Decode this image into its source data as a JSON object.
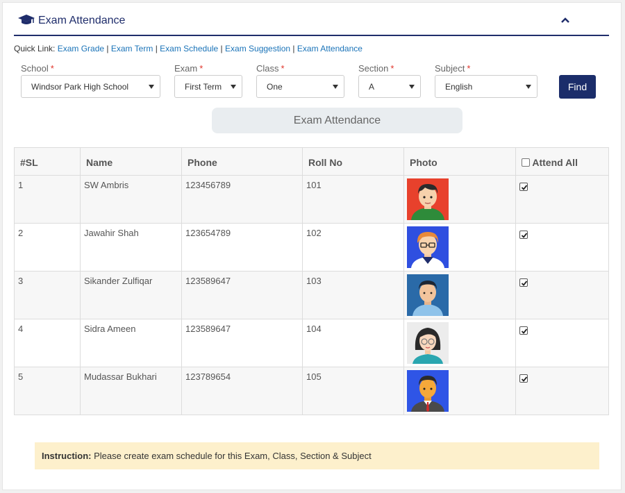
{
  "header": {
    "title": "Exam Attendance",
    "icon": "graduation-cap-icon",
    "collapse_icon": "chevron-up-icon",
    "accent": "#1f2d6b"
  },
  "quick_links": {
    "label": "Quick Link:",
    "links": [
      "Exam Grade",
      "Exam Term",
      "Exam Schedule",
      "Exam Suggestion",
      "Exam Attendance"
    ]
  },
  "filters": {
    "school": {
      "label": "School",
      "value": "Windsor Park High School"
    },
    "exam": {
      "label": "Exam",
      "value": "First Term"
    },
    "class": {
      "label": "Class",
      "value": "One"
    },
    "section": {
      "label": "Section",
      "value": "A"
    },
    "subject": {
      "label": "Subject",
      "value": "English"
    },
    "required_mark": "*",
    "find_label": "Find"
  },
  "banner": {
    "text": "Exam Attendance"
  },
  "table": {
    "headers": [
      "#SL",
      "Name",
      "Phone",
      "Roll No",
      "Photo",
      "Attend All"
    ],
    "rows": [
      {
        "sl": "1",
        "name": "SW Ambris",
        "phone": "123456789",
        "roll": "101",
        "photo": "avatar-boy-green-icon",
        "attend": true
      },
      {
        "sl": "2",
        "name": "Jawahir Shah",
        "phone": "123654789",
        "roll": "102",
        "photo": "avatar-man-glasses-icon",
        "attend": true
      },
      {
        "sl": "3",
        "name": "Sikander Zulfiqar",
        "phone": "123589647",
        "roll": "103",
        "photo": "avatar-man-blue-icon",
        "attend": true
      },
      {
        "sl": "4",
        "name": "Sidra Ameen",
        "phone": "123589647",
        "roll": "104",
        "photo": "avatar-woman-glasses-icon",
        "attend": true
      },
      {
        "sl": "5",
        "name": "Mudassar Bukhari",
        "phone": "123789654",
        "roll": "105",
        "photo": "avatar-man-suit-icon",
        "attend": true
      }
    ]
  },
  "instruction": {
    "label": "Instruction:",
    "text": "Please create exam schedule for this Exam, Class, Section & Subject"
  }
}
